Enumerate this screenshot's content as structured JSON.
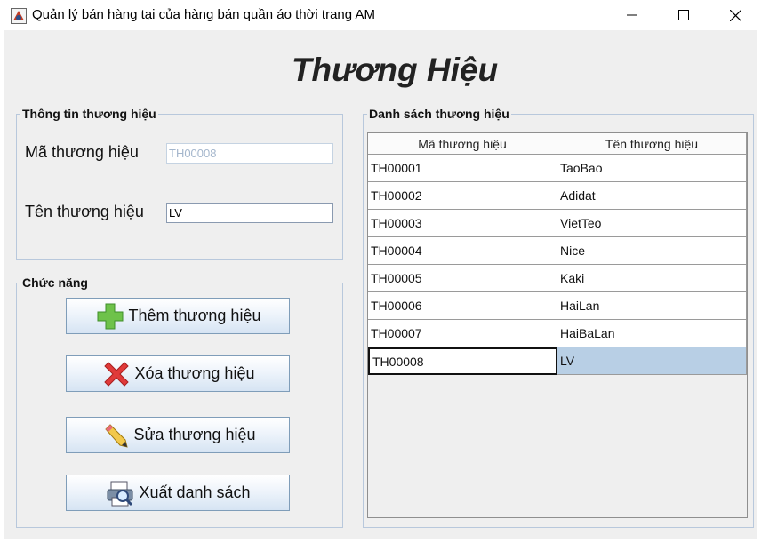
{
  "window": {
    "title": "Quản lý bán hàng tại của hàng bán quần áo thời trang AM",
    "controls": {
      "minimize": "—",
      "maximize": "☐",
      "close": "✕"
    }
  },
  "page": {
    "title": "Thương Hiệu"
  },
  "info_group": {
    "legend": "Thông tin thương hiệu",
    "code_label": "Mã thương hiệu",
    "code_value": "TH00008",
    "name_label": "Tên thương hiệu",
    "name_value": "LV"
  },
  "function_group": {
    "legend": "Chức năng",
    "add_label": "Thêm thương hiệu",
    "delete_label": "Xóa thương hiệu",
    "edit_label": "Sửa thương hiệu",
    "export_label": "Xuất danh sách"
  },
  "list_group": {
    "legend": "Danh sách thương hiệu",
    "columns": [
      "Mã thương hiệu",
      "Tên thương hiệu"
    ],
    "rows": [
      [
        "TH00001",
        "TaoBao"
      ],
      [
        "TH00002",
        "Adidat"
      ],
      [
        "TH00003",
        "VietTeo"
      ],
      [
        "TH00004",
        "Nice"
      ],
      [
        "TH00005",
        "Kaki"
      ],
      [
        "TH00006",
        "HaiLan"
      ],
      [
        "TH00007",
        "HaiBaLan"
      ],
      [
        "TH00008",
        "LV"
      ]
    ],
    "selected_row": 8
  },
  "icons": {
    "add": "plus-icon",
    "delete": "x-icon",
    "edit": "pencil-icon",
    "export": "print-preview-icon"
  },
  "colors": {
    "selection": "#b8cfe5",
    "group_border": "#b8c8dc",
    "add_icon": "#6ec24a",
    "delete_icon": "#e03a3a"
  }
}
